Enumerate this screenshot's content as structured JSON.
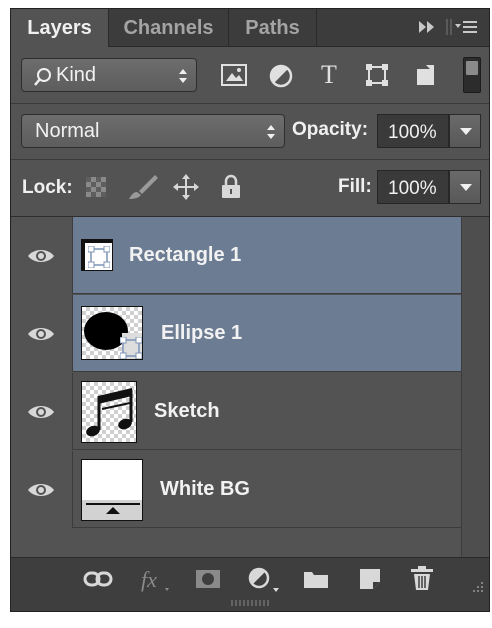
{
  "tabs": [
    {
      "label": "Layers",
      "active": true
    },
    {
      "label": "Channels",
      "active": false
    },
    {
      "label": "Paths",
      "active": false
    }
  ],
  "filter": {
    "label": "Kind"
  },
  "blend_mode": {
    "value": "Normal"
  },
  "opacity": {
    "label": "Opacity:",
    "value": "100%"
  },
  "lock": {
    "label": "Lock:"
  },
  "fill": {
    "label": "Fill:",
    "value": "100%"
  },
  "layers": [
    {
      "name": "Rectangle 1",
      "selected": true,
      "icon": "shape-layer"
    },
    {
      "name": "Ellipse 1",
      "selected": true,
      "icon": "shape-layer"
    },
    {
      "name": "Sketch",
      "selected": false,
      "icon": "music-note"
    },
    {
      "name": "White BG",
      "selected": false,
      "icon": "white-fill"
    }
  ],
  "colors": {
    "selection": "#6b7c93",
    "panel": "#535353",
    "tabbar": "#3c3c3c"
  }
}
